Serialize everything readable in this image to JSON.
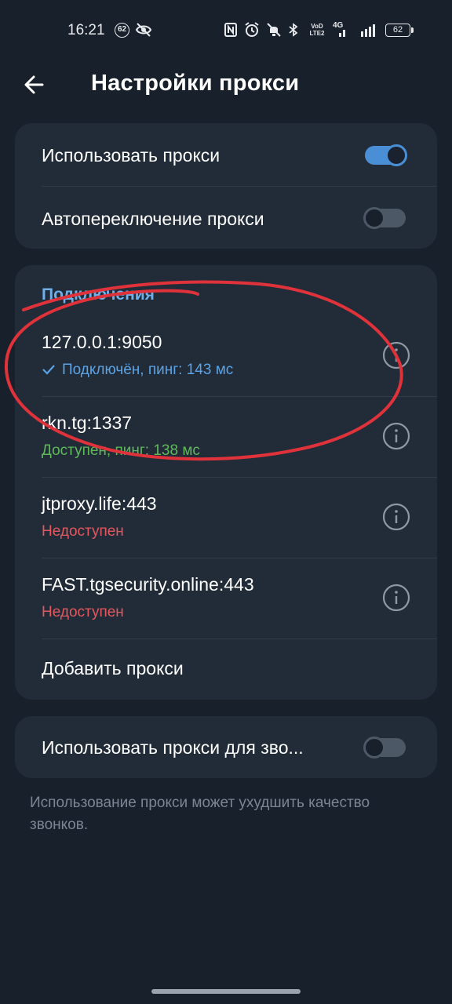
{
  "status_bar": {
    "time": "16:21",
    "notification_count": "62",
    "network_label_1": "VoD LTE2",
    "network_label_2": "4G",
    "battery_level": "62",
    "icons": [
      "eye-off-icon",
      "nfc-icon",
      "alarm-icon",
      "mute-icon",
      "bluetooth-icon",
      "signal-icon",
      "battery-icon"
    ]
  },
  "header": {
    "title": "Настройки прокси",
    "back_icon": "arrow-left-icon"
  },
  "proxy_settings": {
    "use_proxy_label": "Использовать прокси",
    "use_proxy_enabled": true,
    "auto_switch_label": "Автопереключение прокси",
    "auto_switch_enabled": false
  },
  "connections": {
    "section_title": "Подключения",
    "items": [
      {
        "address": "127.0.0.1:9050",
        "status": "Подключён, пинг: 143 мс",
        "state": "connected"
      },
      {
        "address": "rkn.tg:1337",
        "status": "Доступен, пинг: 138 мс",
        "state": "available"
      },
      {
        "address": "jtproxy.life:443",
        "status": "Недоступен",
        "state": "unavailable"
      },
      {
        "address": "FAST.tgsecurity.online:443",
        "status": "Недоступен",
        "state": "unavailable"
      }
    ],
    "add_proxy_label": "Добавить прокси"
  },
  "calls": {
    "label": "Использовать прокси для зво...",
    "enabled": false,
    "note": "Использование прокси может ухудшить качество звонков."
  },
  "colors": {
    "background": "#18202b",
    "card": "#222c38",
    "accent": "#4a8fd6",
    "connected": "#5aa3e6",
    "available": "#5fb95a",
    "unavailable": "#e2585e",
    "annotation": "#e0323a"
  }
}
